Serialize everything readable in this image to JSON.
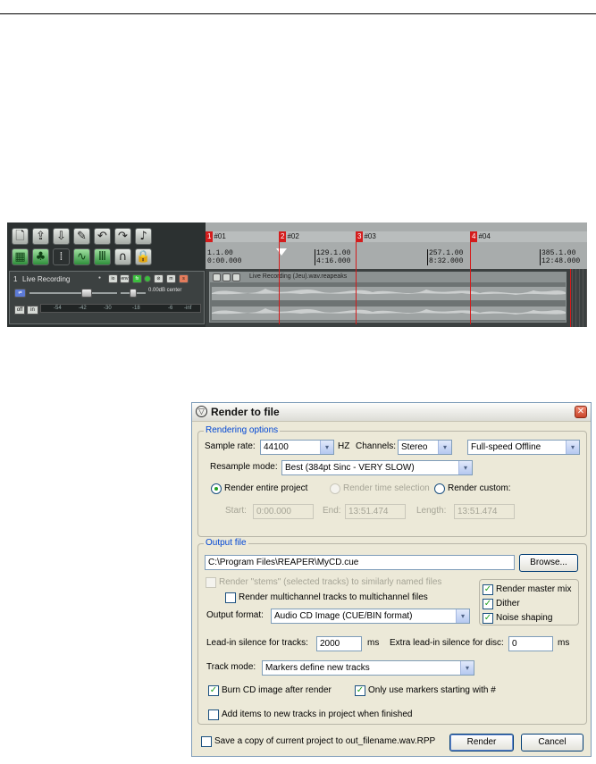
{
  "reaper": {
    "track": {
      "number": "1",
      "name": "Live Recording",
      "volume_pan": "0.00dB center",
      "buttons": [
        "io",
        "env",
        "fx",
        "m",
        "s"
      ],
      "meter_scale": [
        "-54",
        "-42",
        "-30",
        "-18",
        "-6",
        "-inf"
      ],
      "off_label": "off",
      "in_label": "in"
    },
    "markers": [
      {
        "num": "1",
        "label": "#01"
      },
      {
        "num": "2",
        "label": "#02"
      },
      {
        "num": "3",
        "label": "#03"
      },
      {
        "num": "4",
        "label": "#04"
      }
    ],
    "ruler_ticks": [
      {
        "bar": "1.1.00",
        "time": "0:00.000"
      },
      {
        "bar": "129.1.00",
        "time": "4:16.000"
      },
      {
        "bar": "257.1.00",
        "time": "8:32.000"
      },
      {
        "bar": "385.1.00",
        "time": "12:48.000"
      }
    ],
    "item_name": "Live Recording (Jeu).wav.reapeaks"
  },
  "dialog": {
    "title": "Render to file",
    "close_glyph": "✕",
    "rendering_options": {
      "legend": "Rendering options",
      "sample_rate_label": "Sample rate:",
      "sample_rate": "44100",
      "hz": "HZ",
      "channels_label": "Channels:",
      "channels": "Stereo",
      "render_speed": "Full-speed Offline",
      "resample_label": "Resample mode:",
      "resample": "Best (384pt Sinc - VERY SLOW)",
      "render_entire": "Render entire project",
      "render_time_sel": "Render time selection",
      "render_custom": "Render custom:",
      "start_label": "Start:",
      "start": "0:00.000",
      "end_label": "End:",
      "end": "13:51.474",
      "length_label": "Length:",
      "length": "13:51.474"
    },
    "output": {
      "legend": "Output file",
      "path": "C:\\Program Files\\REAPER\\MyCD.cue",
      "browse": "Browse...",
      "stems": "Render \"stems\" (selected tracks) to similarly named files",
      "multichannel": "Render multichannel tracks to multichannel files",
      "master_mix": "Render master mix",
      "dither": "Dither",
      "noise_shaping": "Noise shaping",
      "format_label": "Output format:",
      "format": "Audio CD Image (CUE/BIN format)",
      "leadin_label": "Lead-in silence for tracks:",
      "leadin": "2000",
      "ms": "ms",
      "extra_label": "Extra lead-in silence for disc:",
      "extra": "0",
      "track_mode_label": "Track mode:",
      "track_mode": "Markers define new tracks",
      "burn": "Burn CD image after render",
      "only_markers": "Only use markers starting with #",
      "add_items": "Add items to new tracks in project when finished"
    },
    "save_copy": "Save a copy of current project to out_filename.wav.RPP",
    "render_btn": "Render",
    "cancel_btn": "Cancel",
    "arrow": "▾",
    "check": "✓"
  }
}
